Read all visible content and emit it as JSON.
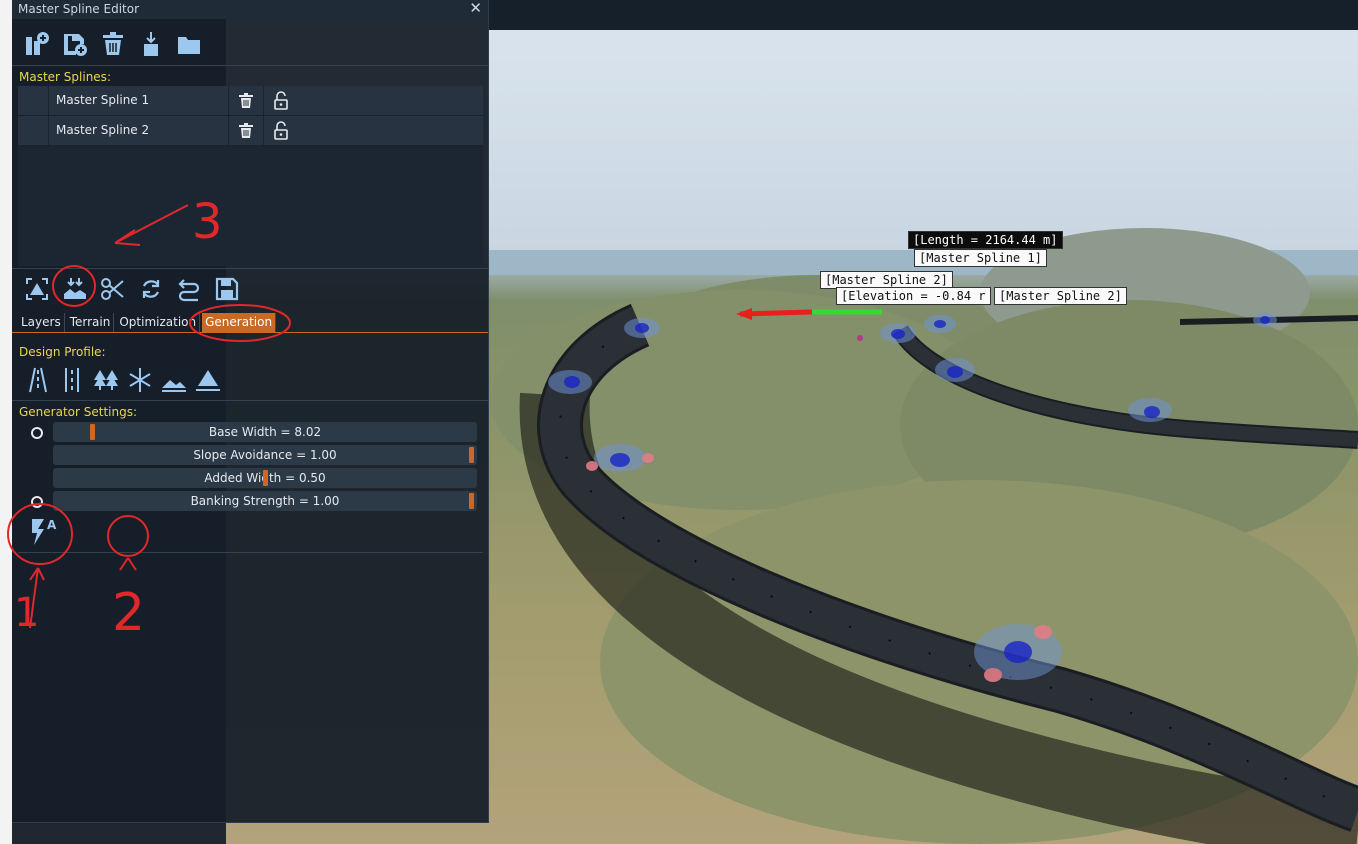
{
  "window": {
    "title": "Master Spline Editor",
    "close_glyph": "✕"
  },
  "toolbar_top": {
    "icons": [
      "add-spline-icon",
      "save-add-icon",
      "delete-icon",
      "import-icon",
      "open-folder-icon"
    ]
  },
  "master_splines": {
    "label": "Master Splines:",
    "rows": [
      {
        "name": "Master Spline 1"
      },
      {
        "name": "Master Spline 2"
      }
    ]
  },
  "toolbar_tools": {
    "icons": [
      "terrain-align-icon",
      "landscape-import-icon",
      "scissors-icon",
      "refresh-icon",
      "swap-icon",
      "save-icon"
    ]
  },
  "tabs": [
    {
      "label": "Layers",
      "active": false
    },
    {
      "label": "Terrain",
      "active": false
    },
    {
      "label": "Optimization",
      "active": false
    },
    {
      "label": "Generation",
      "active": true
    }
  ],
  "design_profile": {
    "label": "Design Profile:",
    "icons": [
      "road-lanes-icon",
      "rail-icon",
      "forest-icon",
      "snow-icon",
      "hills-icon",
      "mountain-icon"
    ]
  },
  "generator": {
    "label": "Generator Settings:",
    "sliders": [
      {
        "text": "Base Width = 8.02",
        "value": 0.08,
        "radio": true
      },
      {
        "text": "Slope Avoidance = 1.00",
        "value": 1.0,
        "radio": false
      },
      {
        "text": "Added Width = 0.50",
        "value": 0.5,
        "radio": false
      },
      {
        "text": "Banking Strength = 1.00",
        "value": 1.0,
        "radio": true
      }
    ]
  },
  "viewport": {
    "labels": {
      "length": "[Length = 2164.44 m]",
      "spline1": "[Master Spline 1]",
      "spline2a": "[Master Spline 2]",
      "elevation": "[Elevation = -0.84 r",
      "spline2b": "[Master Spline 2]"
    }
  },
  "annotations": {
    "numbers": [
      "1",
      "2",
      "3"
    ],
    "color": "#e0282a"
  },
  "colors": {
    "accent": "#c96a24",
    "section": "#e8d84a",
    "icon": "#9cc8f0",
    "panel": "#161e28"
  }
}
